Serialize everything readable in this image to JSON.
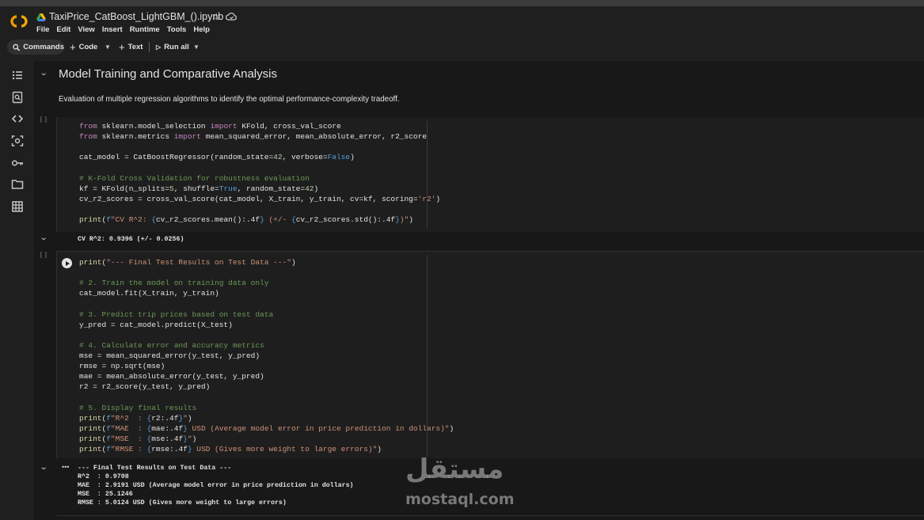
{
  "app": {
    "notebook_title": "TaxiPrice_CatBoost_LightGBM_().ipynb",
    "menu": [
      "File",
      "Edit",
      "View",
      "Insert",
      "Runtime",
      "Tools",
      "Help"
    ]
  },
  "toolbar": {
    "commands_label": "Commands",
    "code_label": "Code",
    "text_label": "Text",
    "run_all_label": "Run all"
  },
  "sidebar": {
    "icons": [
      "table-of-contents-icon",
      "find-replace-icon",
      "code-snippets-icon",
      "variables-icon",
      "secrets-key-icon",
      "files-folder-icon",
      "data-table-icon"
    ]
  },
  "section": {
    "title": "Model Training and Comparative Analysis",
    "description": "Evaluation of multiple regression algorithms to identify the optimal performance-complexity tradeoff."
  },
  "cell1": {
    "bracket": "[ ]",
    "output": "CV R^2: 0.9396 (+/- 0.0256)"
  },
  "cell2": {
    "bracket": "[ ]",
    "output_lines": [
      "--- Final Test Results on Test Data ---",
      "R^2  : 0.9708",
      "MAE  : 2.9191 USD (Average model error in price prediction in dollars)",
      "MSE  : 25.1246",
      "RMSE : 5.0124 USD (Gives more weight to large errors)"
    ]
  },
  "watermark": {
    "arabic": "مستقل",
    "latin": "mostaql.com"
  }
}
